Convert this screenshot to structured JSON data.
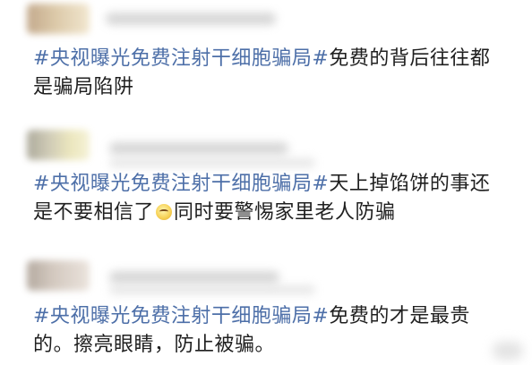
{
  "feed": {
    "posts": [
      {
        "hashtag": "#央视曝光免费注射干细胞骗局#",
        "line1_text": "免费的背后往往都",
        "line2_text": "是骗局陷阱"
      },
      {
        "hashtag": "#央视曝光免费注射干细胞骗局#",
        "line1_text": "天上掉馅饼的事还",
        "line2_before_emoji": "是不要相信了",
        "emoji_icon": "thinking-face-icon",
        "line2_after_emoji": "同时要警惕家里老人防骗"
      },
      {
        "hashtag": "#央视曝光免费注射干细胞骗局#",
        "line1_text": "免费的才是最贵",
        "line2_text": "的。擦亮眼睛，防止被骗。"
      }
    ]
  }
}
